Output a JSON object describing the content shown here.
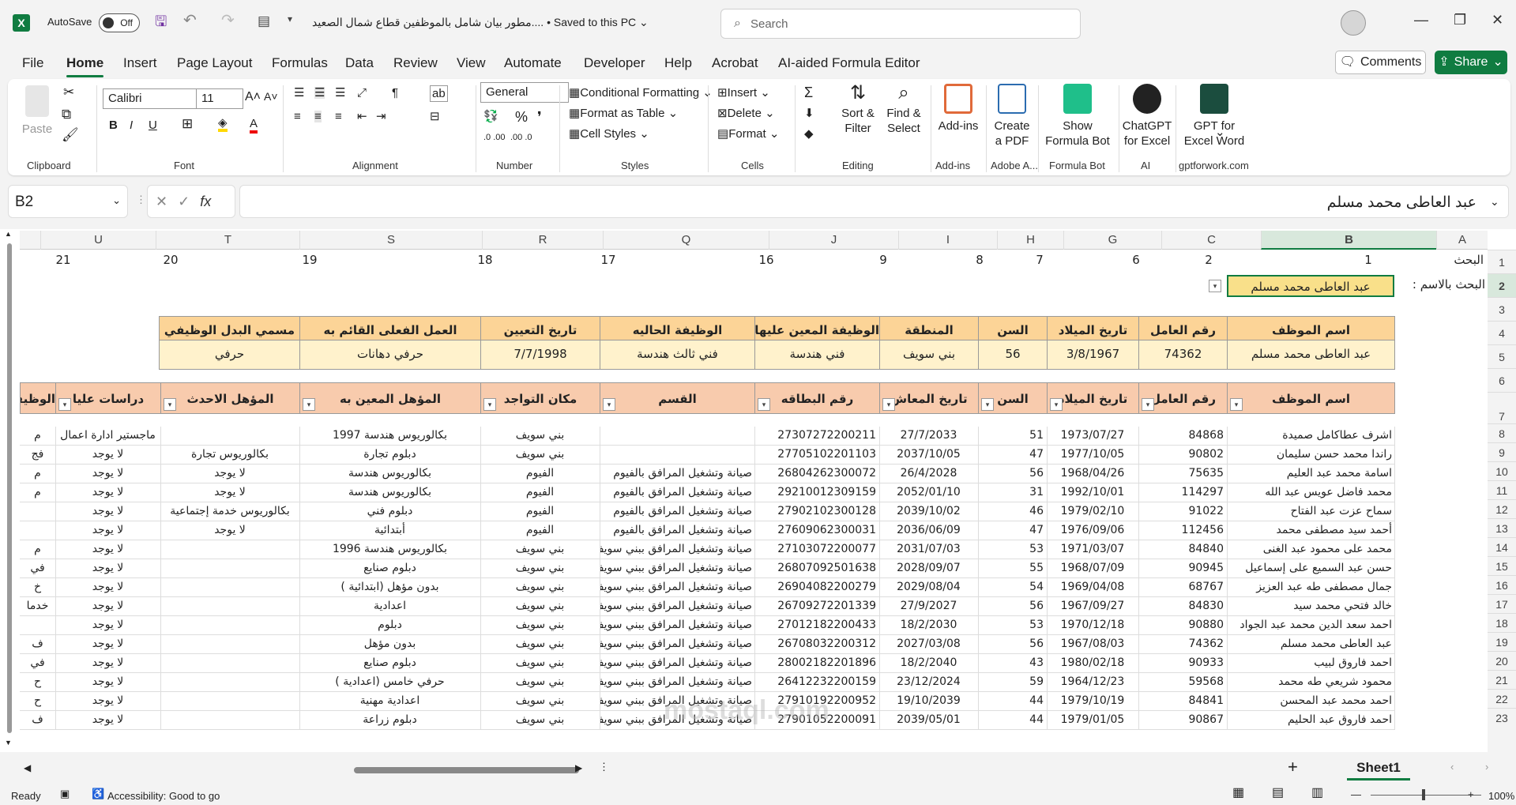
{
  "titlebar": {
    "autosave_label": "AutoSave",
    "autosave_state": "Off",
    "doc_title": "مطور  بيان شامل بالموظفين قطاع شمال الصعيد.... • Saved to this PC ⌄",
    "search_placeholder": "Search"
  },
  "menu": [
    "File",
    "Home",
    "Insert",
    "Page Layout",
    "Formulas",
    "Data",
    "Review",
    "View",
    "Automate",
    "Developer",
    "Help",
    "Acrobat",
    "AI-aided Formula Editor"
  ],
  "comments_label": "Comments",
  "share_label": "Share",
  "ribbon": {
    "paste": "Paste",
    "font_name": "Calibri",
    "font_size": "11",
    "number_format": "General",
    "cond_format": "Conditional Formatting",
    "format_table": "Format as Table",
    "cell_styles": "Cell Styles",
    "insert": "Insert",
    "delete": "Delete",
    "format": "Format",
    "sort_filter": "Sort & Filter",
    "find_select": "Find & Select",
    "add_ins": "Add-ins",
    "create_pdf": "Create a PDF",
    "show_formula_bot": "Show Formula Bot",
    "chatgpt": "ChatGPT for Excel",
    "gpt_word": "GPT for Excel Word",
    "groups": {
      "clipboard": "Clipboard",
      "font": "Font",
      "alignment": "Alignment",
      "number": "Number",
      "styles": "Styles",
      "cells": "Cells",
      "editing": "Editing",
      "addins": "Add-ins",
      "adobe": "Adobe A...",
      "formulabot": "Formula Bot",
      "ai": "AI",
      "gptforwork": "gptforwork.com"
    }
  },
  "namebox": "B2",
  "formula": "عبد العاطى محمد مسلم",
  "columns": [
    "A",
    "B",
    "C",
    "G",
    "H",
    "I",
    "J",
    "Q",
    "R",
    "S",
    "T",
    "U"
  ],
  "rows": [
    "1",
    "2",
    "3",
    "4",
    "5",
    "6",
    "7",
    "8",
    "9",
    "10",
    "11",
    "12",
    "13",
    "14",
    "15",
    "16",
    "17",
    "18",
    "19",
    "20",
    "21",
    "22",
    "23"
  ],
  "row1": {
    "label": "البحث",
    "nums": [
      "1",
      "2",
      "6",
      "7",
      "8",
      "9",
      "16",
      "17",
      "18",
      "19",
      "20",
      "21"
    ]
  },
  "row2": {
    "label": "البحث بالاسم :",
    "value": "عبد العاطى محمد مسلم"
  },
  "card": {
    "headers": [
      "اسم الموظف",
      "رقم العامل",
      "تاريخ الميلاد",
      "السن",
      "المنطقة",
      "الوظيفة المعين عليها",
      "الوظيفة الحاليه",
      "تاريخ التعيين",
      "العمل الفعلى القائم به",
      "مسمي البدل الوظيفي"
    ],
    "values": [
      "عبد العاطى محمد مسلم",
      "74362",
      "3/8/1967",
      "56",
      "بني سويف",
      "فني هندسة",
      "فني ثالث هندسة",
      "7/7/1998",
      "حرفي دهانات",
      "حرفي"
    ]
  },
  "table": {
    "headers": [
      "اسم الموظف",
      "رقم العامل",
      "تاريخ الميلاد",
      "السن",
      "تاريخ المعاش",
      "رقم البطاقه",
      "القسم",
      "مكان التواجد",
      "المؤهل المعين به",
      "المؤهل الاحدث",
      "دراسات عليا",
      "الوظيفة"
    ],
    "rows": [
      [
        "اشرف عطاكامل صميدة",
        "84868",
        "1973/07/27",
        "51",
        "27/7/2033",
        "27307272200211",
        "",
        "بني سويف",
        "بكالوريوس هندسة 1997",
        "",
        "ماجستير ادارة اعمال",
        "م"
      ],
      [
        "راندا محمد حسن سليمان",
        "90802",
        "1977/10/05",
        "47",
        "2037/10/05",
        "27705102201103",
        "",
        "بني سويف",
        "دبلوم تجارة",
        "بكالوريوس تجارة",
        "لا يوجد",
        "فج"
      ],
      [
        "اسامة محمد عبد العليم",
        "75635",
        "1968/04/26",
        "56",
        "26/4/2028",
        "26804262300072",
        "صيانة وتشغيل المرافق بالفيوم",
        "الفيوم",
        "بكالوريوس هندسة",
        "لا يوجد",
        "لا يوجد",
        "م"
      ],
      [
        "محمد فاضل عويس عبد الله",
        "114297",
        "1992/10/01",
        "31",
        "2052/01/10",
        "29210012309159",
        "صيانة وتشغيل المرافق بالفيوم",
        "الفيوم",
        "بكالوريوس هندسة",
        "لا يوجد",
        "لا يوجد",
        "م"
      ],
      [
        "سماح عزت عبد الفتاح",
        "91022",
        "1979/02/10",
        "46",
        "2039/10/02",
        "27902102300128",
        "صيانة وتشغيل المرافق بالفيوم",
        "الفيوم",
        "دبلوم فني",
        "بكالوريوس خدمة إجتماعية",
        "لا يوجد",
        ""
      ],
      [
        "أحمد سيد مصطفى محمد",
        "112456",
        "1976/09/06",
        "47",
        "2036/06/09",
        "27609062300031",
        "صيانة وتشغيل المرافق بالفيوم",
        "الفيوم",
        "أبتدائية",
        "لا يوجد",
        "لا يوجد",
        ""
      ],
      [
        "محمد على محمود عبد الغنى",
        "84840",
        "1971/03/07",
        "53",
        "2031/07/03",
        "27103072200077",
        "صيانة وتشغيل المرافق ببني سويف",
        "بني سويف",
        "بكالوريوس هندسة 1996",
        "",
        "لا يوجد",
        "م"
      ],
      [
        "حسن عبد السميع على إسماعيل",
        "90945",
        "1968/07/09",
        "55",
        "2028/09/07",
        "26807092501638",
        "صيانة وتشغيل المرافق ببني سويف",
        "بني سويف",
        "دبلوم صنايع",
        "",
        "لا يوجد",
        "في"
      ],
      [
        "جمال مصطفى طه عبد العزيز",
        "68767",
        "1969/04/08",
        "54",
        "2029/08/04",
        "26904082200279",
        "صيانة وتشغيل المرافق ببني سويف",
        "بني سويف",
        "بدون مؤهل (ابتدائية )",
        "",
        "لا يوجد",
        "خ"
      ],
      [
        "خالد فتحي محمد سيد",
        "84830",
        "1967/09/27",
        "56",
        "27/9/2027",
        "26709272201339",
        "صيانة وتشغيل المرافق ببني سويف",
        "بني سويف",
        "اعدادية",
        "",
        "لا يوجد",
        "خدما"
      ],
      [
        "احمد سعد الدين محمد عبد الجواد",
        "90880",
        "1970/12/18",
        "53",
        "18/2/2030",
        "27012182200433",
        "صيانة وتشغيل المرافق ببني سويف",
        "بني سويف",
        "دبلوم",
        "",
        "لا يوجد",
        ""
      ],
      [
        "عبد العاطى محمد مسلم",
        "74362",
        "1967/08/03",
        "56",
        "2027/03/08",
        "26708032200312",
        "صيانة وتشغيل المرافق ببني سويف",
        "بني سويف",
        "بدون مؤهل",
        "",
        "لا يوجد",
        "ف"
      ],
      [
        "احمد فاروق لبيب",
        "90933",
        "1980/02/18",
        "43",
        "18/2/2040",
        "28002182201896",
        "صيانة وتشغيل المرافق ببني سويف",
        "بني سويف",
        "دبلوم صنايع",
        "",
        "لا يوجد",
        "في"
      ],
      [
        "محمود شريعي طه محمد",
        "59568",
        "1964/12/23",
        "59",
        "23/12/2024",
        "26412232200159",
        "صيانة وتشغيل المرافق ببني سويف",
        "بني سويف",
        "حرفي خامس (اعدادية )",
        "",
        "لا يوجد",
        "ح"
      ],
      [
        "احمد محمد عبد المحسن",
        "84841",
        "1979/10/19",
        "44",
        "19/10/2039",
        "27910192200952",
        "صيانة وتشغيل المرافق ببني سويف",
        "بني سويف",
        "اعدادية مهنية",
        "",
        "لا يوجد",
        "ح"
      ],
      [
        "احمد فاروق عبد الحليم",
        "90867",
        "1979/01/05",
        "44",
        "2039/05/01",
        "27901052200091",
        "صيانة وتشغيل المرافق ببني سويف",
        "بني سويف",
        "دبلوم زراعة",
        "",
        "لا يوجد",
        "ف"
      ]
    ]
  },
  "sheet_tab": "Sheet1",
  "status": {
    "ready": "Ready",
    "accessibility": "Accessibility: Good to go",
    "zoom": "100%"
  },
  "watermark": "mostaql.com"
}
